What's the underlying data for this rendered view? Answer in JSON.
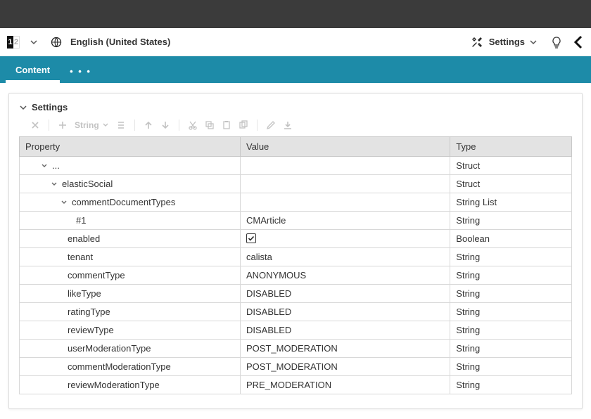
{
  "topbar": {
    "logo_left": "1",
    "logo_right": "2",
    "language": "English (United States)",
    "settings_label": "Settings"
  },
  "tabs": {
    "content": "Content",
    "more": "• • •"
  },
  "section": {
    "title": "Settings"
  },
  "toolbar": {
    "type_label": "String"
  },
  "table": {
    "headers": {
      "property": "Property",
      "value": "Value",
      "type": "Type"
    },
    "rows": [
      {
        "indent": 20,
        "twisty": "down",
        "prop": "...",
        "value": "",
        "type": "Struct"
      },
      {
        "indent": 34,
        "twisty": "down",
        "prop": "elasticSocial",
        "value": "",
        "type": "Struct"
      },
      {
        "indent": 48,
        "twisty": "down",
        "prop": "commentDocumentTypes",
        "value": "",
        "type": "String List"
      },
      {
        "indent": 72,
        "twisty": "",
        "prop": "#1",
        "value": "CMArticle",
        "type": "String"
      },
      {
        "indent": 60,
        "twisty": "",
        "prop": "enabled",
        "value_check": true,
        "type": "Boolean"
      },
      {
        "indent": 60,
        "twisty": "",
        "prop": "tenant",
        "value": "calista",
        "type": "String"
      },
      {
        "indent": 60,
        "twisty": "",
        "prop": "commentType",
        "value": "ANONYMOUS",
        "type": "String"
      },
      {
        "indent": 60,
        "twisty": "",
        "prop": "likeType",
        "value": "DISABLED",
        "type": "String"
      },
      {
        "indent": 60,
        "twisty": "",
        "prop": "ratingType",
        "value": "DISABLED",
        "type": "String"
      },
      {
        "indent": 60,
        "twisty": "",
        "prop": "reviewType",
        "value": "DISABLED",
        "type": "String"
      },
      {
        "indent": 60,
        "twisty": "",
        "prop": "userModerationType",
        "value": "POST_MODERATION",
        "type": "String"
      },
      {
        "indent": 60,
        "twisty": "",
        "prop": "commentModerationType",
        "value": "POST_MODERATION",
        "type": "String"
      },
      {
        "indent": 60,
        "twisty": "",
        "prop": "reviewModerationType",
        "value": "PRE_MODERATION",
        "type": "String"
      }
    ]
  }
}
